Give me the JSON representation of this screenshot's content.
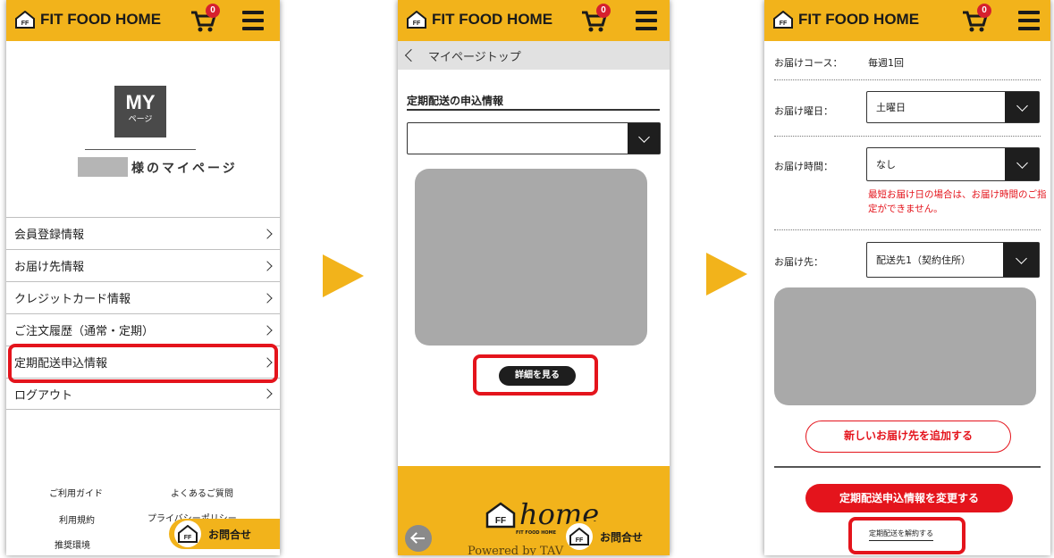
{
  "colors": {
    "brand_yellow": "#F2B31B",
    "accent_red": "#E4141C",
    "dark": "#1E1E1E",
    "placeholder_gray": "#A9A9A9"
  },
  "header": {
    "brand": "FIT FOOD HOME",
    "logo_letters": "FF",
    "cart_count": "0",
    "cart_icon": "cart-icon",
    "menu_icon": "hamburger-icon"
  },
  "screen1": {
    "my_badge_big": "MY",
    "my_badge_small": "ページ",
    "mypage_title": "様のマイページ",
    "menu_items": [
      {
        "label": "会員登録情報"
      },
      {
        "label": "お届け先情報"
      },
      {
        "label": "クレジットカード情報"
      },
      {
        "label": "ご注文履歴（通常・定期）"
      },
      {
        "label": "定期配送申込情報"
      },
      {
        "label": "ログアウト"
      }
    ],
    "footer_links": [
      "ご利用ガイド",
      "よくあるご質問",
      "利用規約",
      "プライバシーポリシー",
      "推奨環境"
    ],
    "contact_label": "お問合せ"
  },
  "screen2": {
    "breadcrumb": "マイページトップ",
    "section_title": "定期配送の申込情報",
    "select_value": "",
    "detail_button": "詳細を見る",
    "home_word": "home",
    "home_sub": "FIT FOOD HOME",
    "powered_by": "Powered by TAV",
    "contact_label": "お問合せ"
  },
  "screen3": {
    "course_label": "お届けコース：",
    "course_value": "毎週1回",
    "day_label": "お届け曜日：",
    "day_value": "土曜日",
    "time_label": "お届け時間：",
    "time_value": "なし",
    "warning": "最短お届け日の場合は、お届け時間のご指定ができません。",
    "dest_label": "お届け先：",
    "dest_value": "配送先1（契約住所）",
    "add_dest_button": "新しいお届け先を追加する",
    "change_button": "定期配送申込情報を変更する",
    "cancel_link": "定期配送を解約する"
  }
}
